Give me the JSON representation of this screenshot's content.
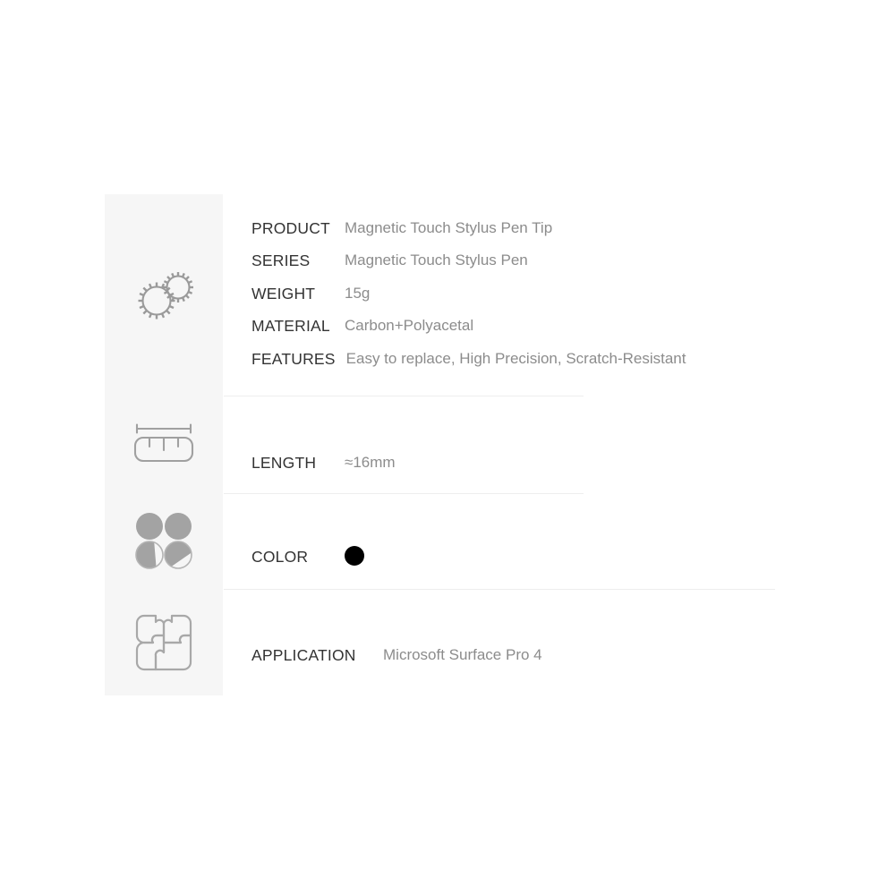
{
  "sheet": {
    "type": "product-specification-table",
    "background_color": "#ffffff",
    "icon_column_color": "#f6f6f6",
    "divider_color": "#eeeeee",
    "label_color": "#333333",
    "value_color": "#8c8c8c"
  },
  "blocks": [
    {
      "icon": "gears-icon",
      "icon_description": "two interlocking cogwheels outline",
      "rows": [
        {
          "label": "PRODUCT",
          "value": "Magnetic Touch Stylus Pen Tip"
        },
        {
          "label": "SERIES",
          "value": "Magnetic Touch Stylus Pen"
        },
        {
          "label": "WEIGHT",
          "value": "15g"
        },
        {
          "label": "MATERIAL",
          "value": "Carbon+Polyacetal"
        },
        {
          "label": "FEATURES",
          "value": "Easy to replace, High Precision, Scratch-Resistant"
        }
      ]
    },
    {
      "icon": "ruler-icon",
      "icon_description": "dimension line above rounded measuring block with tick marks",
      "rows": [
        {
          "label": "LENGTH",
          "value": "≈16mm"
        }
      ]
    },
    {
      "icon": "color-swatches-icon",
      "icon_description": "four circles in two by two grid, two solid and two half filled",
      "rows": [
        {
          "label": "COLOR",
          "value": "",
          "swatch_color": "#000000"
        }
      ]
    },
    {
      "icon": "puzzle-icon",
      "icon_description": "four interlocking jigsaw puzzle pieces forming a square",
      "rows": [
        {
          "label": "APPLICATION",
          "value": "Microsoft Surface Pro 4"
        }
      ]
    }
  ]
}
